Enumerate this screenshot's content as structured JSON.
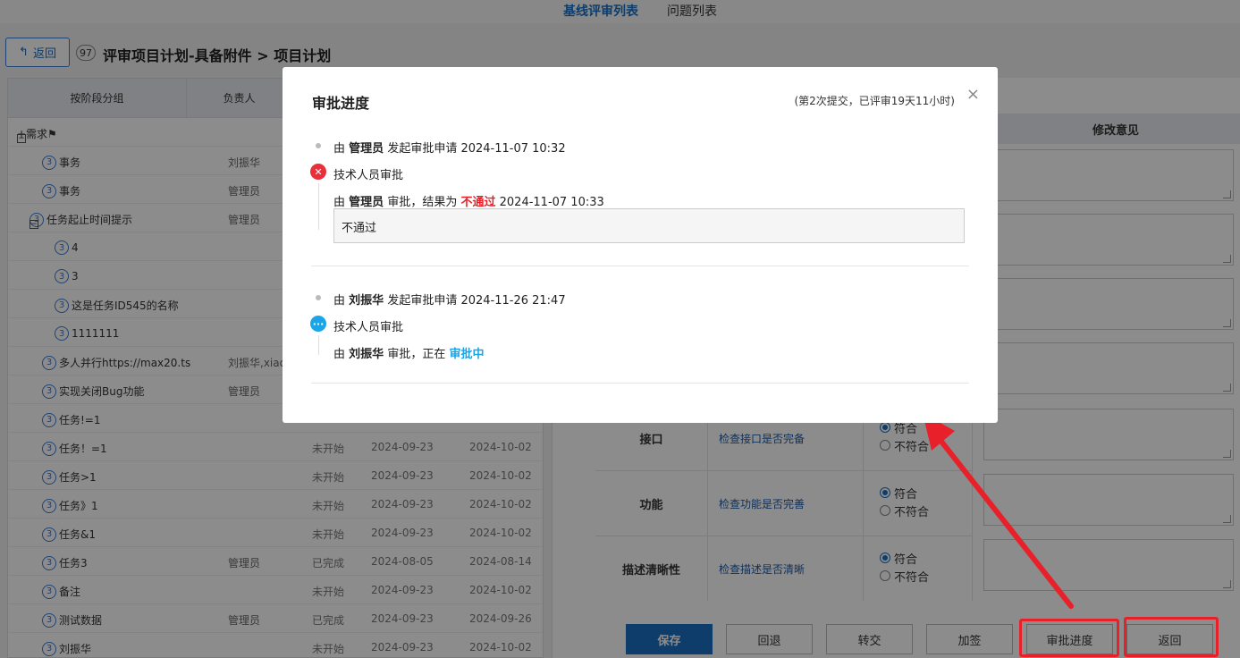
{
  "top_tabs": {
    "baseline_review": "基线评审列表",
    "issue_list": "问题列表"
  },
  "header": {
    "back_label": "返回",
    "count": "97",
    "title": "评审项目计划-具备附件 > 项目计划"
  },
  "left_table": {
    "col_group": "按阶段分组",
    "col_owner": "负责人",
    "rows": [
      {
        "name": "+需求⚑",
        "owner": "",
        "status": "",
        "start": "",
        "end": ""
      },
      {
        "name": "事务",
        "owner": "刘振华",
        "status": "",
        "start": "",
        "end": ""
      },
      {
        "name": "事务",
        "owner": "管理员",
        "status": "",
        "start": "",
        "end": ""
      },
      {
        "name": "任务起止时间提示",
        "owner": "管理员",
        "status": "",
        "start": "",
        "end": ""
      },
      {
        "name": "4",
        "owner": "",
        "status": "",
        "start": "",
        "end": ""
      },
      {
        "name": "3",
        "owner": "",
        "status": "",
        "start": "",
        "end": ""
      },
      {
        "name": "这是任务ID545的名称",
        "owner": "",
        "status": "",
        "start": "",
        "end": ""
      },
      {
        "name": "1111111",
        "owner": "",
        "status": "",
        "start": "",
        "end": ""
      },
      {
        "name": "多人并行https://max20.ts",
        "owner": "刘振华,xiao",
        "status": "",
        "start": "",
        "end": ""
      },
      {
        "name": "实现关闭Bug功能",
        "owner": "管理员",
        "status": "",
        "start": "",
        "end": ""
      },
      {
        "name": "任务!=1",
        "owner": "",
        "status": "",
        "start": "",
        "end": ""
      },
      {
        "name": "任务！=1",
        "owner": "",
        "status": "未开始",
        "start": "2024-09-23",
        "end": "2024-10-02"
      },
      {
        "name": "任务>1",
        "owner": "",
        "status": "未开始",
        "start": "2024-09-23",
        "end": "2024-10-02"
      },
      {
        "name": "任务》1",
        "owner": "",
        "status": "未开始",
        "start": "2024-09-23",
        "end": "2024-10-02"
      },
      {
        "name": "任务&1",
        "owner": "",
        "status": "未开始",
        "start": "2024-09-23",
        "end": "2024-10-02"
      },
      {
        "name": "任务3",
        "owner": "管理员",
        "status": "已完成",
        "start": "2024-08-05",
        "end": "2024-08-14"
      },
      {
        "name": "备注",
        "owner": "",
        "status": "未开始",
        "start": "2024-09-23",
        "end": "2024-10-02"
      },
      {
        "name": "测试数据",
        "owner": "管理员",
        "status": "已完成",
        "start": "2024-09-23",
        "end": "2024-09-26"
      },
      {
        "name": "刘振华",
        "owner": "",
        "status": "未开始",
        "start": "2024-09-23",
        "end": "2024-10-02"
      }
    ],
    "row_badge": "3"
  },
  "right_panel": {
    "col_comment": "修改意见",
    "criteria": [
      {
        "name": "接口",
        "desc": "检查接口是否完备",
        "opt_yes": "符合",
        "opt_no": "不符合"
      },
      {
        "name": "功能",
        "desc": "检查功能是否完善",
        "opt_yes": "符合",
        "opt_no": "不符合"
      },
      {
        "name": "描述清晰性",
        "desc": "检查描述是否清晰",
        "opt_yes": "符合",
        "opt_no": "不符合"
      }
    ]
  },
  "bottom_buttons": {
    "save": "保存",
    "rollback": "回退",
    "transfer": "转交",
    "add_sign": "加签",
    "progress": "审批进度",
    "back": "返回"
  },
  "modal": {
    "title": "审批进度",
    "subtitle": "(第2次提交，已评审19天11小时)",
    "close": "×",
    "round1": {
      "by": "由",
      "initiator": "管理员",
      "action": "发起审批申请 2024-11-07 10:32",
      "node": "技术人员审批",
      "approver": "管理员",
      "result_prefix": "审批，结果为",
      "result": "不通过",
      "result_time": "2024-11-07 10:33",
      "comment": "不通过"
    },
    "round2": {
      "by": "由",
      "initiator": "刘振华",
      "action": "发起审批申请 2024-11-26 21:47",
      "node": "技术人员审批",
      "approver": "刘振华",
      "status_prefix": "审批，正在",
      "status": "审批中"
    }
  }
}
